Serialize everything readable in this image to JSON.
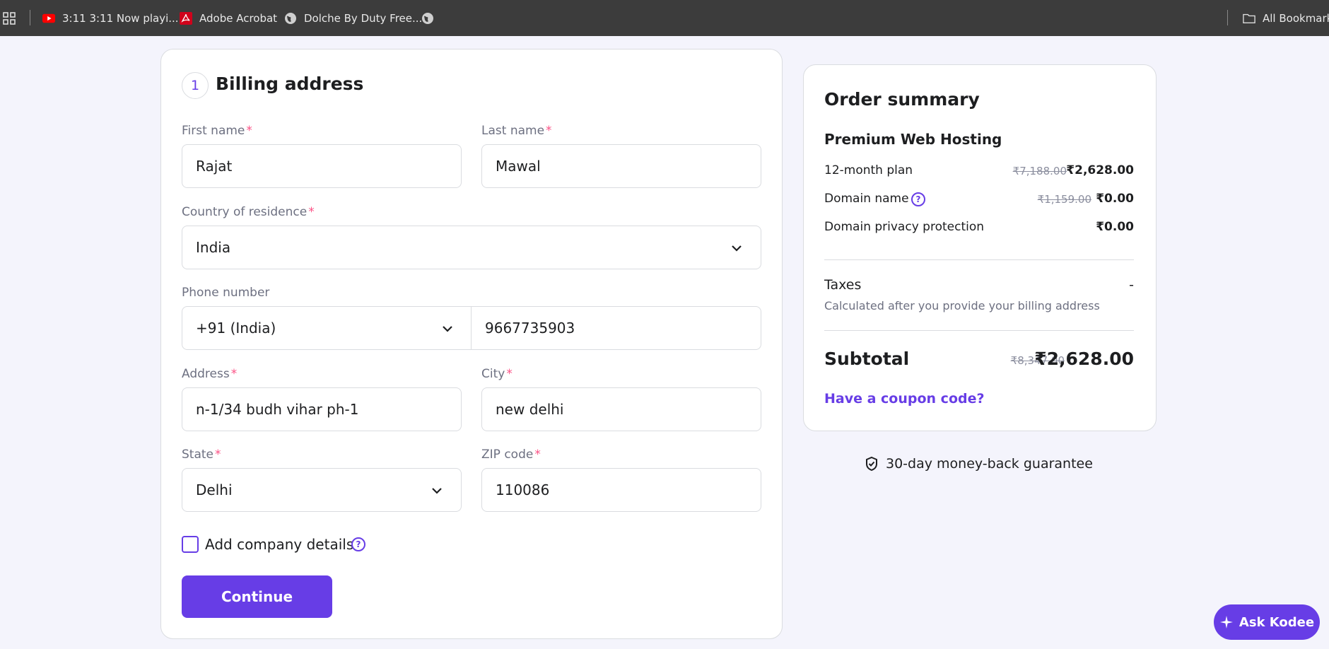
{
  "bookmarks_bar": {
    "items": [
      {
        "label": "3:11 3:11 Now playi...",
        "icon": "youtube-icon"
      },
      {
        "label": "Adobe Acrobat",
        "icon": "pdf-icon"
      },
      {
        "label": "Dolche By Duty Free...",
        "icon": "globe-icon"
      },
      {
        "label": "",
        "icon": "globe-icon"
      }
    ],
    "all_bookmarks": "All Bookmarks"
  },
  "billing": {
    "step": "1",
    "title": "Billing address",
    "first_name": {
      "label": "First name",
      "required": "*",
      "value": "Rajat"
    },
    "last_name": {
      "label": "Last name",
      "required": "*",
      "value": "Mawal"
    },
    "country": {
      "label": "Country of residence",
      "required": "*",
      "value": "India"
    },
    "phone": {
      "label": "Phone number",
      "code": "+91 (India)",
      "value": "9667735903"
    },
    "address": {
      "label": "Address",
      "required": "*",
      "value": "n-1/34 budh vihar ph-1"
    },
    "city": {
      "label": "City",
      "required": "*",
      "value": "new delhi"
    },
    "state": {
      "label": "State",
      "required": "*",
      "value": "Delhi"
    },
    "zip": {
      "label": "ZIP code",
      "required": "*",
      "value": "110086"
    },
    "company_checkbox_label": "Add company details",
    "continue_label": "Continue"
  },
  "order_summary": {
    "title": "Order summary",
    "product": "Premium Web Hosting",
    "lines": [
      {
        "label": "12-month plan",
        "old_price": "₹7,188.00",
        "price": "₹2,628.00"
      },
      {
        "label": "Domain name",
        "old_price": "₹1,159.00",
        "price": "₹0.00"
      },
      {
        "label": "Domain privacy protection",
        "old_price": "",
        "price": "₹0.00"
      }
    ],
    "taxes_label": "Taxes",
    "taxes_value": "-",
    "taxes_note": "Calculated after you provide your billing address",
    "subtotal_label": "Subtotal",
    "subtotal_old": "₹8,347.00",
    "subtotal": "₹2,628.00",
    "coupon_link": "Have a coupon code?"
  },
  "guarantee": "30-day money-back guarantee",
  "chat_button": "Ask Kodee",
  "colors": {
    "accent": "#673de6",
    "required": "#fc5185",
    "page_bg": "#f4f4fc"
  }
}
